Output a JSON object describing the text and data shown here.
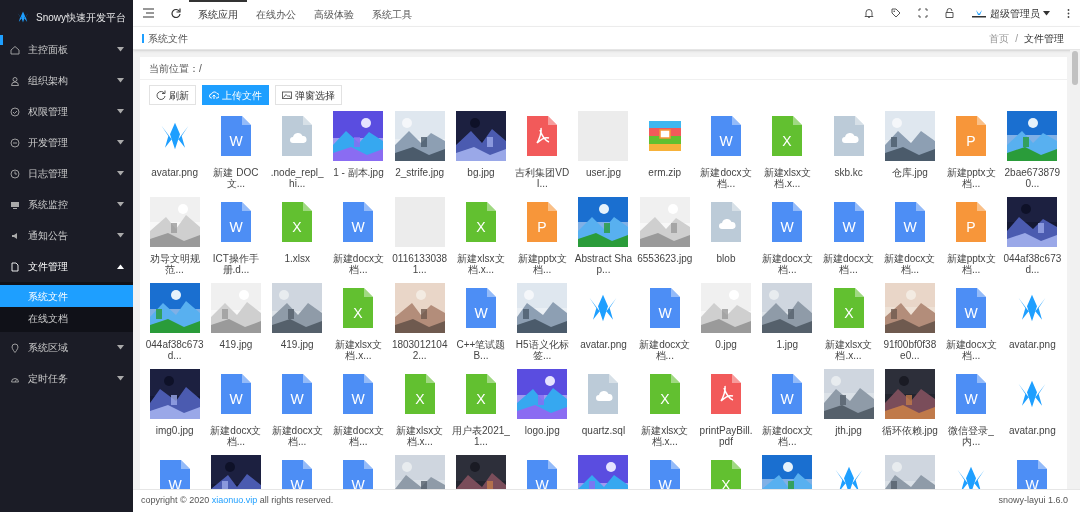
{
  "app": {
    "title": "Snowy快速开发平台"
  },
  "sidebar": {
    "items": [
      {
        "label": "主控面板",
        "expanded": false
      },
      {
        "label": "组织架构",
        "expanded": false
      },
      {
        "label": "权限管理",
        "expanded": false
      },
      {
        "label": "开发管理",
        "expanded": false
      },
      {
        "label": "日志管理",
        "expanded": false
      },
      {
        "label": "系统监控",
        "expanded": false
      },
      {
        "label": "通知公告",
        "expanded": false
      },
      {
        "label": "文件管理",
        "expanded": true,
        "children": [
          {
            "label": "系统文件",
            "selected": true
          },
          {
            "label": "在线文档",
            "selected": false
          }
        ]
      },
      {
        "label": "系统区域",
        "expanded": false
      },
      {
        "label": "定时任务",
        "expanded": false
      }
    ]
  },
  "header": {
    "menu": [
      {
        "label": "系统应用",
        "selected": true
      },
      {
        "label": "在线办公",
        "selected": false
      },
      {
        "label": "高级体验",
        "selected": false
      },
      {
        "label": "系统工具",
        "selected": false
      }
    ],
    "user": "超级管理员"
  },
  "page_tab": "系统文件",
  "breadcrumb": [
    "首页",
    "文件管理"
  ],
  "breadcrumb_separator": "/",
  "location": "当前位置：/",
  "buttons": [
    {
      "kind": "refresh",
      "label": "刷新"
    },
    {
      "kind": "upload",
      "label": "上传文件"
    },
    {
      "kind": "picker",
      "label": "弹窗选择"
    }
  ],
  "files": [
    {
      "kind": "logo",
      "name": "avatar.png"
    },
    {
      "kind": "word",
      "letter": "W",
      "name": "新建 DOC 文..."
    },
    {
      "kind": "cloud",
      "name": ".node_repl_hi..."
    },
    {
      "kind": "picture",
      "name": "1 - 副本.jpg"
    },
    {
      "kind": "picture",
      "name": "2_strife.jpg"
    },
    {
      "kind": "picture",
      "name": "bg.jpg"
    },
    {
      "kind": "pdf",
      "name": "吉利集团VDI..."
    },
    {
      "kind": "blank",
      "name": "user.jpg"
    },
    {
      "kind": "zip",
      "name": "erm.zip"
    },
    {
      "kind": "word",
      "letter": "W",
      "name": "新建docx文档..."
    },
    {
      "kind": "excel",
      "letter": "X",
      "name": "新建xlsx文档.x..."
    },
    {
      "kind": "cloud",
      "name": "skb.kc"
    },
    {
      "kind": "picture",
      "name": "仓库.jpg"
    },
    {
      "kind": "ppt",
      "letter": "P",
      "name": "新建pptx文档..."
    },
    {
      "kind": "picture",
      "name": "2bae6738790..."
    },
    {
      "kind": "picture",
      "name": "劝导文明规范..."
    },
    {
      "kind": "word",
      "letter": "W",
      "name": "ICT操作手册.d..."
    },
    {
      "kind": "excel",
      "letter": "X",
      "name": "1.xlsx"
    },
    {
      "kind": "word",
      "letter": "W",
      "name": "新建docx文档..."
    },
    {
      "kind": "blank",
      "name": "01161330381..."
    },
    {
      "kind": "excel",
      "letter": "X",
      "name": "新建xlsx文档.x..."
    },
    {
      "kind": "ppt",
      "letter": "P",
      "name": "新建pptx文档..."
    },
    {
      "kind": "picture",
      "name": "Abstract Shap..."
    },
    {
      "kind": "picture",
      "name": "6553623.jpg"
    },
    {
      "kind": "cloud",
      "name": "blob"
    },
    {
      "kind": "word",
      "letter": "W",
      "name": "新建docx文档..."
    },
    {
      "kind": "word",
      "letter": "W",
      "name": "新建docx文档..."
    },
    {
      "kind": "word",
      "letter": "W",
      "name": "新建docx文档..."
    },
    {
      "kind": "ppt",
      "letter": "P",
      "name": "新建pptx文档..."
    },
    {
      "kind": "picture",
      "name": "044af38c673d..."
    },
    {
      "kind": "picture",
      "name": "044af38c673d..."
    },
    {
      "kind": "picture",
      "name": "419.jpg"
    },
    {
      "kind": "picture",
      "name": "419.jpg"
    },
    {
      "kind": "excel",
      "letter": "X",
      "name": "新建xlsx文档.x..."
    },
    {
      "kind": "picture",
      "name": "18030121042..."
    },
    {
      "kind": "word",
      "letter": "W",
      "name": "C++笔试题B..."
    },
    {
      "kind": "picture",
      "name": "H5语义化标签..."
    },
    {
      "kind": "logo",
      "name": "avatar.png"
    },
    {
      "kind": "word",
      "letter": "W",
      "name": "新建docx文档..."
    },
    {
      "kind": "picture",
      "name": "0.jpg"
    },
    {
      "kind": "picture",
      "name": "1.jpg"
    },
    {
      "kind": "excel",
      "letter": "X",
      "name": "新建xlsx文档.x..."
    },
    {
      "kind": "picture",
      "name": "91f00bf0f38e0..."
    },
    {
      "kind": "word",
      "letter": "W",
      "name": "新建docx文档..."
    },
    {
      "kind": "logo",
      "name": "avatar.png"
    },
    {
      "kind": "picture",
      "name": "img0.jpg"
    },
    {
      "kind": "word",
      "letter": "W",
      "name": "新建docx文档..."
    },
    {
      "kind": "word",
      "letter": "W",
      "name": "新建docx文档..."
    },
    {
      "kind": "word",
      "letter": "W",
      "name": "新建docx文档..."
    },
    {
      "kind": "excel",
      "letter": "X",
      "name": "新建xlsx文档.x..."
    },
    {
      "kind": "excel",
      "letter": "X",
      "name": "用户表2021_1..."
    },
    {
      "kind": "picture",
      "name": "logo.jpg"
    },
    {
      "kind": "cloud",
      "name": "quartz.sql"
    },
    {
      "kind": "excel",
      "letter": "X",
      "name": "新建xlsx文档.x..."
    },
    {
      "kind": "pdf",
      "name": "printPayBill.pdf"
    },
    {
      "kind": "word",
      "letter": "W",
      "name": "新建docx文档..."
    },
    {
      "kind": "picture",
      "name": "jth.jpg"
    },
    {
      "kind": "picture",
      "name": "循环依赖.jpg"
    },
    {
      "kind": "word",
      "letter": "W",
      "name": "微信登录_内..."
    },
    {
      "kind": "logo",
      "name": "avatar.png"
    },
    {
      "kind": "word",
      "letter": "W"
    },
    {
      "kind": "picture"
    },
    {
      "kind": "word",
      "letter": "W"
    },
    {
      "kind": "word",
      "letter": "W"
    },
    {
      "kind": "picture"
    },
    {
      "kind": "picture"
    },
    {
      "kind": "word",
      "letter": "W"
    },
    {
      "kind": "picture"
    },
    {
      "kind": "word",
      "letter": "W"
    },
    {
      "kind": "excel",
      "letter": "X"
    },
    {
      "kind": "picture"
    },
    {
      "kind": "logo"
    },
    {
      "kind": "picture"
    },
    {
      "kind": "logo"
    },
    {
      "kind": "word",
      "letter": "W"
    }
  ],
  "footer": {
    "before": "copyright © 2020",
    "link": "xiaonuo.vip",
    "after": "all rights reserved.",
    "version": "snowy-layui 1.6.0"
  }
}
